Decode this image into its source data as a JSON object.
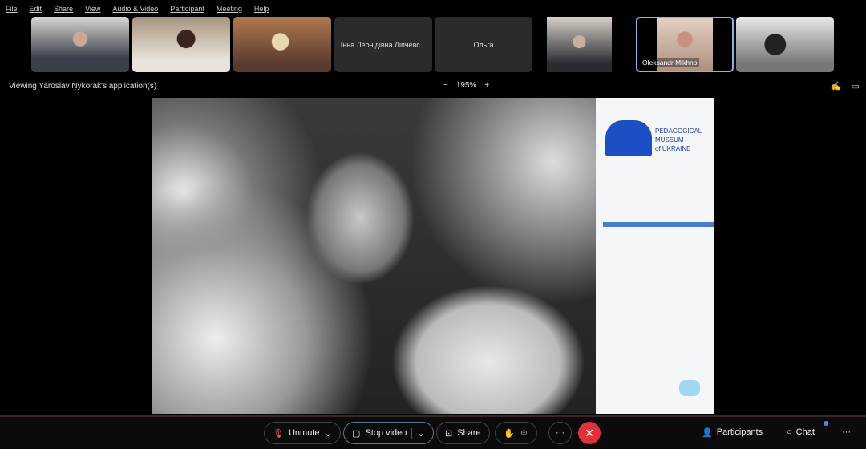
{
  "menu": [
    "File",
    "Edit",
    "Share",
    "View",
    "Audio & Video",
    "Participant",
    "Meeting",
    "Help"
  ],
  "participants": [
    {
      "name": "",
      "video": true
    },
    {
      "name": "",
      "video": true
    },
    {
      "name": "",
      "video": true
    },
    {
      "name": "Інна Леонідівна Ліпчевс...",
      "video": false
    },
    {
      "name": "Ольга",
      "video": false
    },
    {
      "name": "",
      "video": true
    },
    {
      "name": "Oleksandr Mikhno",
      "video": true,
      "active": true
    },
    {
      "name": "",
      "video": true
    }
  ],
  "viewing": "Viewing Yaroslav Nykorak's application(s)",
  "zoom": {
    "minus": "−",
    "level": "195%",
    "plus": "+"
  },
  "slide": {
    "logo_text": [
      "PEDAGOGICAL",
      "MUSEUM",
      "of UKRAINE"
    ]
  },
  "toolbar": {
    "unmute": "Unmute",
    "stop_video": "Stop video",
    "share": "Share",
    "more": "···",
    "end": "✕",
    "participants": "Participants",
    "chat": "Chat",
    "overflow": "···"
  },
  "colors": {
    "end": "#e0303a",
    "accent": "#8ab4e8",
    "logo": "#1d4fc4"
  }
}
